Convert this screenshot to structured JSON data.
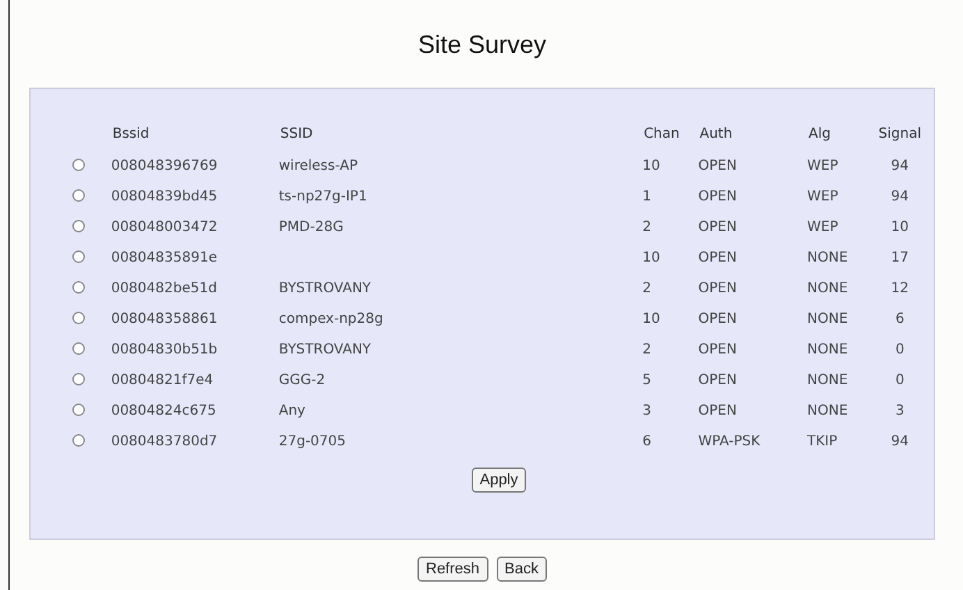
{
  "title": "Site Survey",
  "table": {
    "columns": [
      "Bssid",
      "SSID",
      "Chan",
      "Auth",
      "Alg",
      "Signal"
    ],
    "rows": [
      {
        "selected": false,
        "bssid": "008048396769",
        "ssid": "wireless-AP",
        "chan": "10",
        "auth": "OPEN",
        "alg": "WEP",
        "signal": "94"
      },
      {
        "selected": false,
        "bssid": "00804839bd45",
        "ssid": "ts-np27g-IP1",
        "chan": "1",
        "auth": "OPEN",
        "alg": "WEP",
        "signal": "94"
      },
      {
        "selected": false,
        "bssid": "008048003472",
        "ssid": "PMD-28G",
        "chan": "2",
        "auth": "OPEN",
        "alg": "WEP",
        "signal": "10"
      },
      {
        "selected": false,
        "bssid": "00804835891e",
        "chan": "10",
        "auth": "OPEN",
        "alg": "NONE",
        "signal": "17"
      },
      {
        "selected": false,
        "bssid": "0080482be51d",
        "ssid": "BYSTROVANY",
        "chan": "2",
        "auth": "OPEN",
        "alg": "NONE",
        "signal": "12"
      },
      {
        "selected": false,
        "bssid": "008048358861",
        "ssid": "compex-np28g",
        "chan": "10",
        "auth": "OPEN",
        "alg": "NONE",
        "signal": "6"
      },
      {
        "selected": false,
        "bssid": "00804830b51b",
        "ssid": "BYSTROVANY",
        "chan": "2",
        "auth": "OPEN",
        "alg": "NONE",
        "signal": "0"
      },
      {
        "selected": false,
        "bssid": "00804821f7e4",
        "ssid": "GGG-2",
        "chan": "5",
        "auth": "OPEN",
        "alg": "NONE",
        "signal": "0"
      },
      {
        "selected": false,
        "bssid": "00804824c675",
        "ssid": "Any",
        "chan": "3",
        "auth": "OPEN",
        "alg": "NONE",
        "signal": "3"
      },
      {
        "selected": false,
        "bssid": "0080483780d7",
        "ssid": "27g-0705",
        "chan": "6",
        "auth": "WPA-PSK",
        "alg": "TKIP",
        "signal": "94"
      }
    ]
  },
  "apply_button": "Apply",
  "buttons": [
    "Refresh",
    "Back"
  ]
}
